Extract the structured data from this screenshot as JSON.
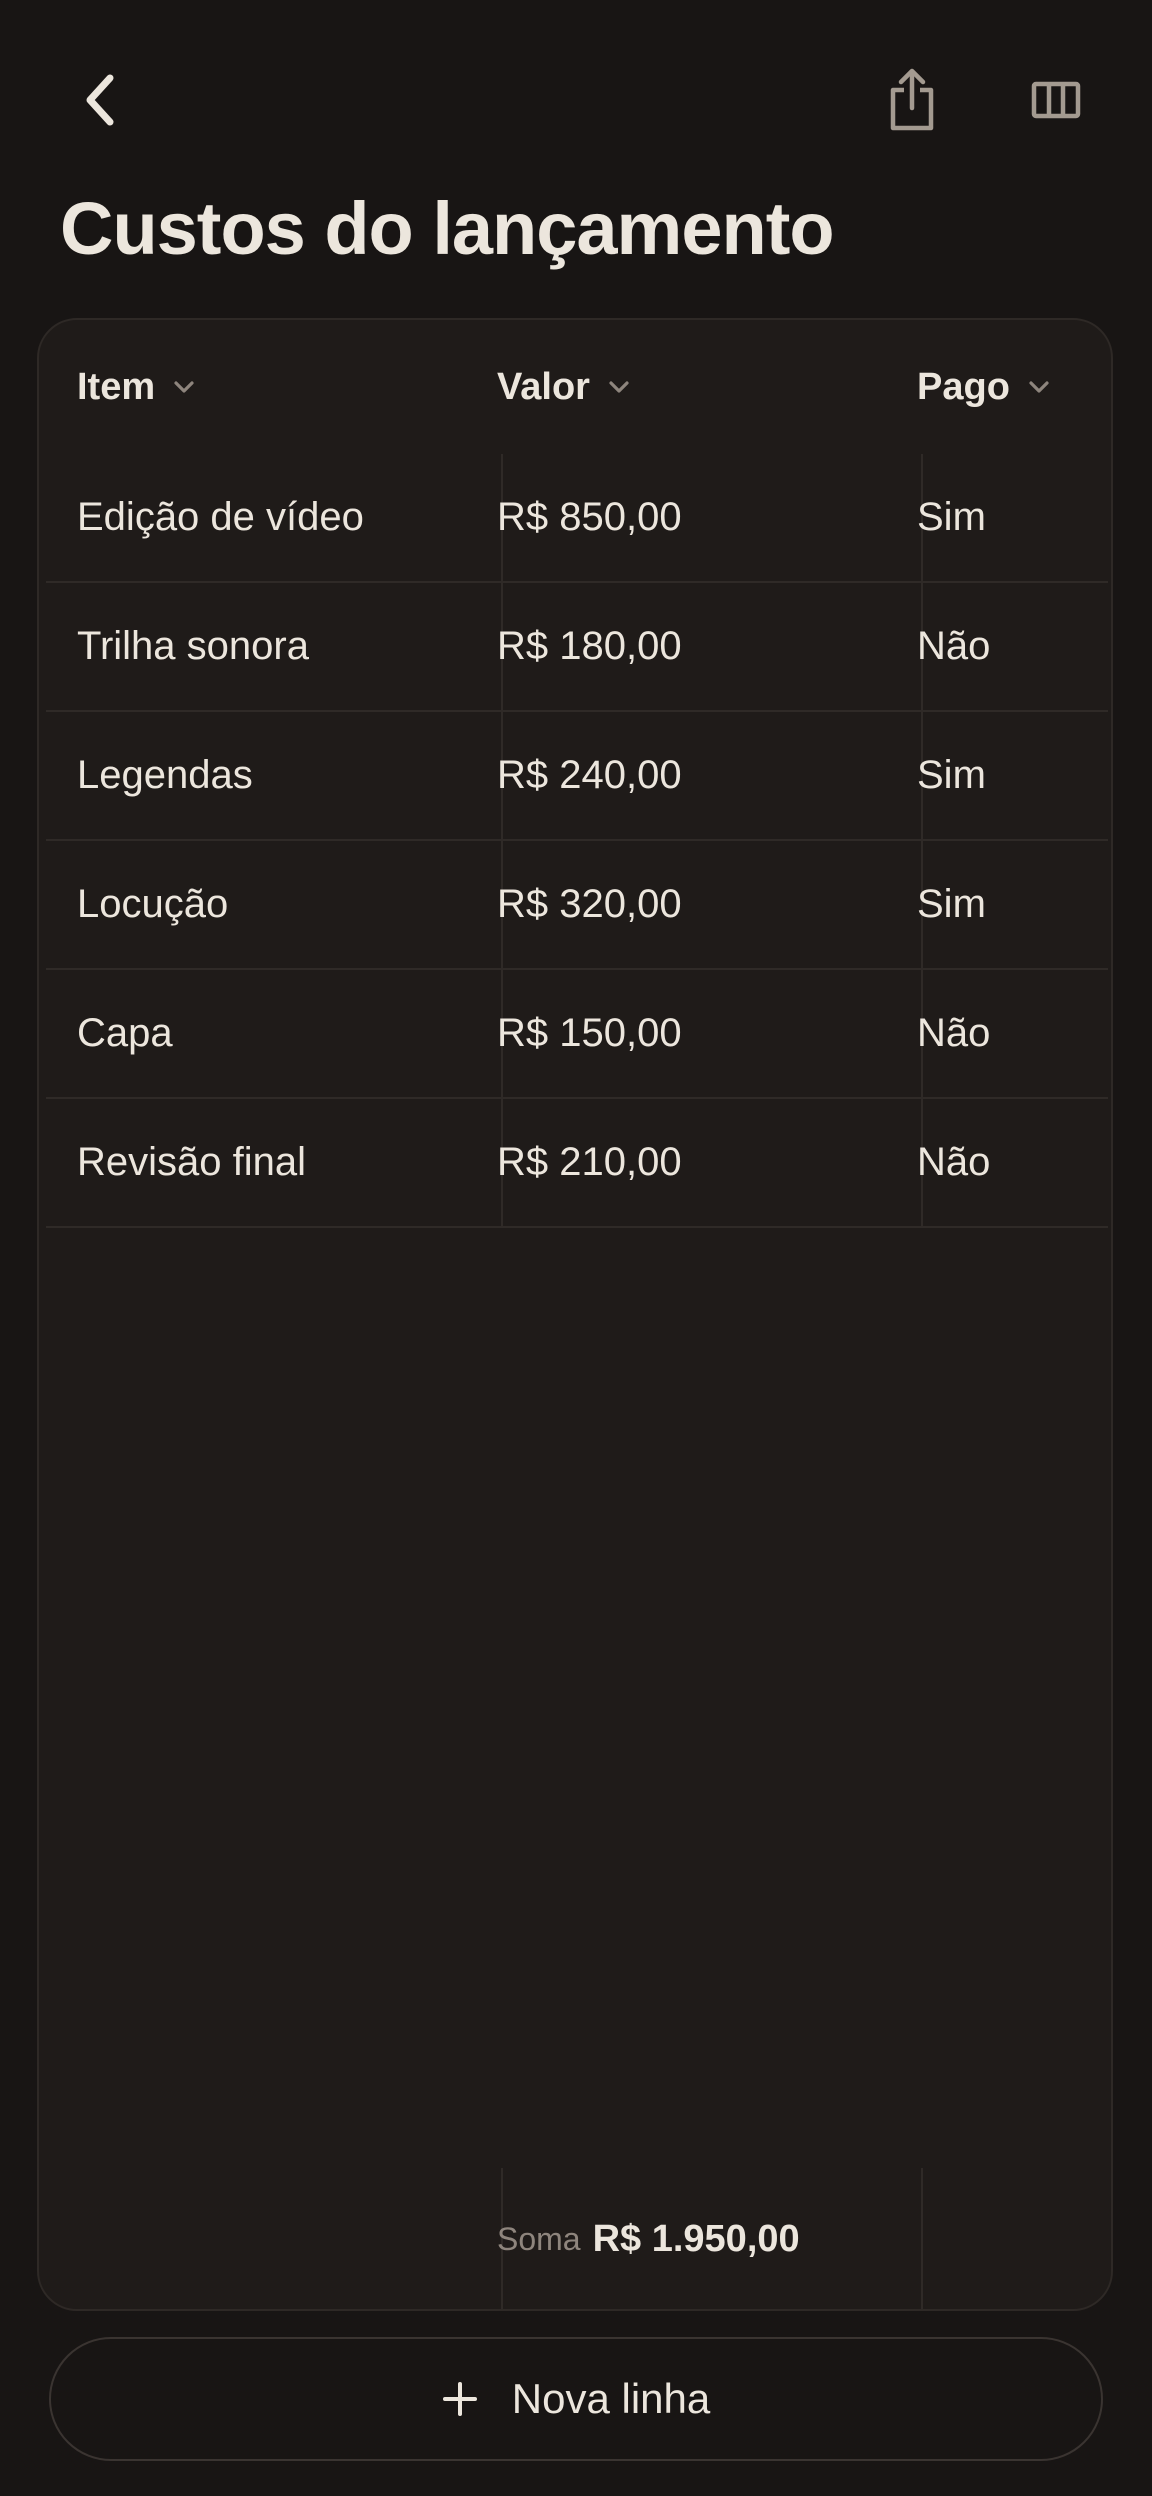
{
  "page": {
    "title": "Custos do lançamento"
  },
  "toolbar": {
    "back_icon": "chevron-left-icon",
    "share_icon": "share-icon",
    "columns_icon": "columns-icon"
  },
  "table": {
    "columns": [
      {
        "label": "Item"
      },
      {
        "label": "Valor"
      },
      {
        "label": "Pago"
      }
    ],
    "rows": [
      {
        "item": "Edição de vídeo",
        "valor": "R$ 850,00",
        "pago": "Sim"
      },
      {
        "item": "Trilha sonora",
        "valor": "R$ 180,00",
        "pago": "Não"
      },
      {
        "item": "Legendas",
        "valor": "R$ 240,00",
        "pago": "Sim"
      },
      {
        "item": "Locução",
        "valor": "R$ 320,00",
        "pago": "Sim"
      },
      {
        "item": "Capa",
        "valor": "R$ 150,00",
        "pago": "Não"
      },
      {
        "item": "Revisão final",
        "valor": "R$ 210,00",
        "pago": "Não"
      }
    ],
    "summary": {
      "label": "Soma",
      "value": "R$ 1.950,00"
    }
  },
  "actions": {
    "new_row_label": "Nova linha"
  },
  "colors": {
    "background": "#181514",
    "card": "#1F1B19",
    "text": "#ECE6DD",
    "muted": "#8E857D",
    "icon": "#A39A90"
  }
}
